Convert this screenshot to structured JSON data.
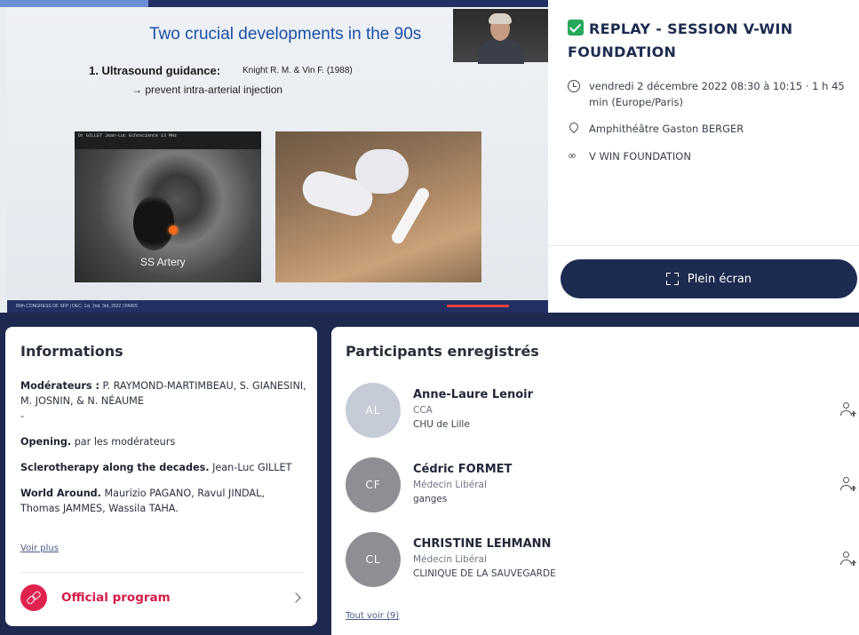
{
  "video": {
    "progress": 0.27,
    "slide": {
      "title": "Two crucial developments in the 90s",
      "point": "1.  Ultrasound guidance:",
      "reference": "Knight R. M.  & Vin F. (1988)",
      "subpoint": "→ prevent intra-arterial injection",
      "us_label": "SS Artery",
      "us_header": "Dr GILLET Jean-Luc        Echoscience        13 MHz",
      "footer": "80th CONGRESS OF SFP | DEC. 1st, 2nd, 3rd, 2022 | PARIS"
    }
  },
  "session": {
    "title": "REPLAY - SESSION V-WIN FOUNDATION",
    "datetime": "vendredi 2 décembre 2022 08:30 à 10:15 · 1 h 45 min (Europe/Paris)",
    "location": "Amphithéâtre Gaston BERGER",
    "organizer": "V WIN FOUNDATION",
    "fullscreen_label": "Plein écran",
    "icons": {
      "status": "check-square-icon",
      "datetime": "clock-icon",
      "location": "map-pin-icon",
      "organizer": "grid-org-icon",
      "fullscreen": "expand-icon"
    },
    "status_color": "#26a95a"
  },
  "info": {
    "title": "Informations",
    "moderators_label": "Modérateurs :",
    "moderators": "P. RAYMOND-MARTIMBEAU, S. GIANESINI, M. JOSNIN, & N. NÉAUME",
    "dash": "-",
    "items": [
      {
        "title": "Opening.",
        "speaker": "par les modérateurs"
      },
      {
        "title": "Sclerotherapy along the decades.",
        "speaker": "Jean-Luc GILLET"
      },
      {
        "title": "World Around.",
        "speaker": "Maurizio PAGANO, Ravul JINDAL, Thomas JAMMES, Wassila TAHA."
      }
    ],
    "voir_plus": "Voir plus",
    "program_label": "Official program",
    "program_color": "#e0224f"
  },
  "participants": {
    "title": "Participants enregistrés",
    "list": [
      {
        "initials": "AL",
        "name": "Anne-Laure Lenoir",
        "role": "CCA",
        "org": "CHU de Lille",
        "color": "#c5ccd6"
      },
      {
        "initials": "CF",
        "name": "Cédric FORMET",
        "role": "Médecin Libéral",
        "org": "ganges",
        "color": "#8d8f94"
      },
      {
        "initials": "CL",
        "name": "CHRISTINE LEHMANN",
        "role": "Médecin Libéral",
        "org": "CLINIQUE DE LA SAUVEGARDE",
        "color": "#8d8f94"
      }
    ],
    "see_all": "Tout voir (9)"
  }
}
